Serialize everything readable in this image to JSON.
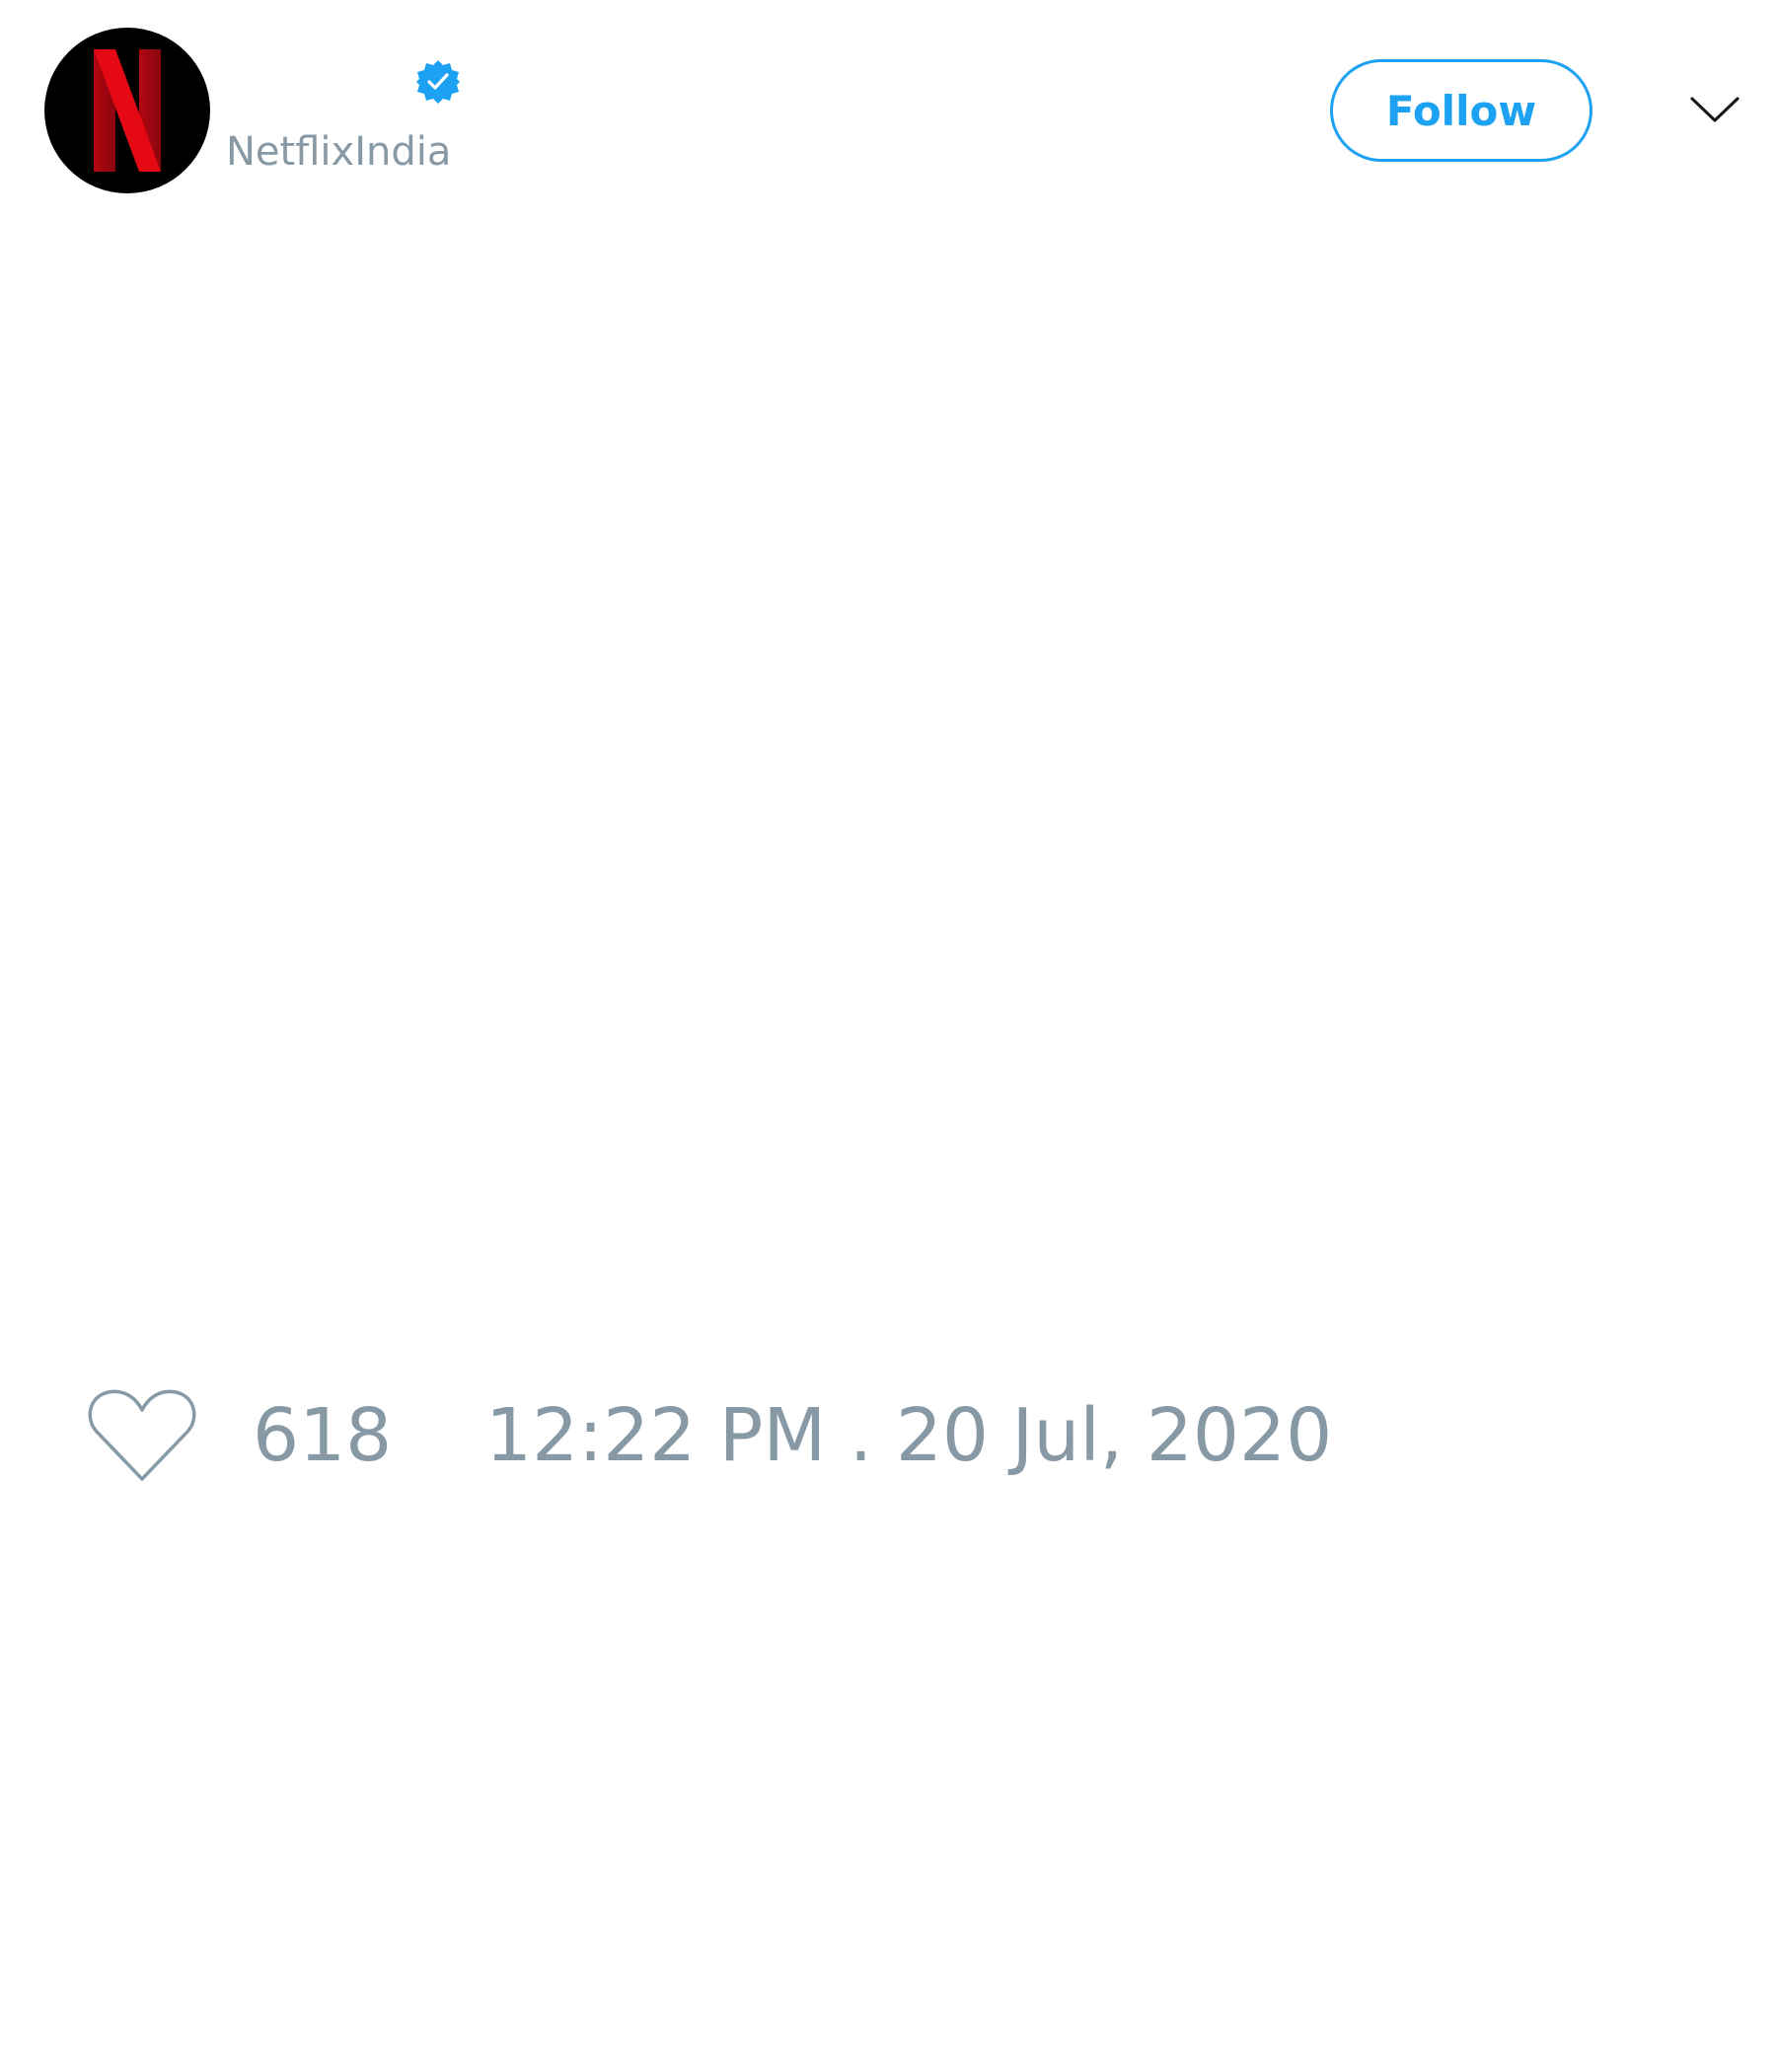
{
  "tweet": {
    "author": {
      "display_name": "",
      "handle": "NetflixIndia",
      "avatar_icon": "netflix-logo-icon",
      "verified": true,
      "verified_icon": "verified-badge-icon"
    },
    "header": {
      "follow_label": "Follow",
      "menu_icon": "chevron-down-icon"
    },
    "footer": {
      "like_icon": "heart-outline-icon",
      "like_count": "618",
      "timestamp": "12:22 PM . 20 Jul, 2020"
    }
  },
  "colors": {
    "accent": "#1da1f2",
    "muted_text": "#8899a6",
    "avatar_background": "#000000",
    "logo_red": "#e50914",
    "background": "#ffffff"
  }
}
